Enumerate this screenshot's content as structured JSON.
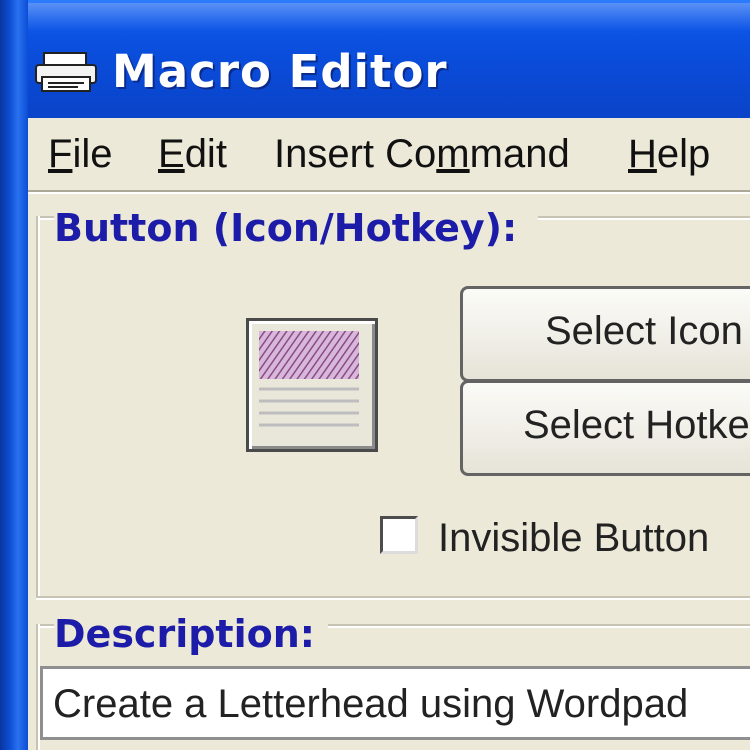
{
  "window": {
    "title": "Macro Editor",
    "title_icon": "printer-icon"
  },
  "menu": {
    "items": [
      {
        "label": "File",
        "mnemonic": "F"
      },
      {
        "label": "Edit",
        "mnemonic": "E"
      },
      {
        "label": "Insert Command",
        "mnemonic": "m"
      },
      {
        "label": "Help",
        "mnemonic": "H"
      }
    ]
  },
  "button_group": {
    "label": "Button (Icon/Hotkey):",
    "select_icon_label": "Select Icon",
    "select_hotkey_label": "Select Hotkey",
    "invisible_label": "Invisible Button",
    "invisible_checked": false,
    "preview_icon": "letterhead-icon"
  },
  "description_group": {
    "label": "Description:",
    "value": "Create a Letterhead using Wordpad"
  },
  "colors": {
    "title_bar": "#0a4ad6",
    "group_label": "#1c1ca8",
    "face": "#ece9d8"
  }
}
